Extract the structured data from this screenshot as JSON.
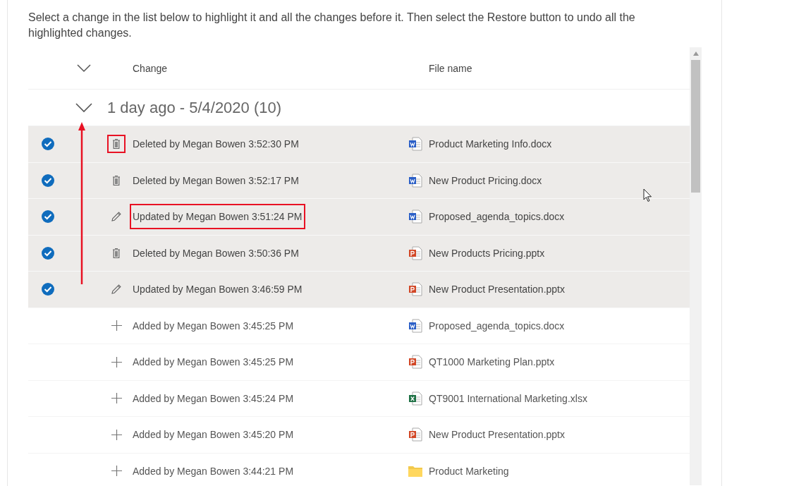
{
  "instructions": "Select a change in the list below to highlight it and all the changes before it. Then select the Restore button to undo all the highlighted changes.",
  "columns": {
    "change": "Change",
    "file_name": "File name"
  },
  "group": {
    "label": "1 day ago - 5/4/2020 (10)",
    "expanded": true
  },
  "rows": [
    {
      "kind": "deleted",
      "selected": true,
      "change": "Deleted by Megan Bowen 3:52:30 PM",
      "file": {
        "kind": "word",
        "name": "Product Marketing Info.docx"
      },
      "icon_marked": true,
      "change_marked": false
    },
    {
      "kind": "deleted",
      "selected": true,
      "change": "Deleted by Megan Bowen 3:52:17 PM",
      "file": {
        "kind": "word",
        "name": "New Product Pricing.docx"
      },
      "icon_marked": false,
      "change_marked": false
    },
    {
      "kind": "updated",
      "selected": true,
      "change": "Updated by Megan Bowen 3:51:24 PM",
      "file": {
        "kind": "word",
        "name": "Proposed_agenda_topics.docx"
      },
      "icon_marked": false,
      "change_marked": true
    },
    {
      "kind": "deleted",
      "selected": true,
      "change": "Deleted by Megan Bowen 3:50:36 PM",
      "file": {
        "kind": "powerpoint",
        "name": "New Products Pricing.pptx"
      },
      "icon_marked": false,
      "change_marked": false
    },
    {
      "kind": "updated",
      "selected": true,
      "change": "Updated by Megan Bowen 3:46:59 PM",
      "file": {
        "kind": "powerpoint",
        "name": "New Product Presentation.pptx"
      },
      "icon_marked": false,
      "change_marked": false
    },
    {
      "kind": "added",
      "selected": false,
      "change": "Added by Megan Bowen 3:45:25 PM",
      "file": {
        "kind": "word",
        "name": "Proposed_agenda_topics.docx"
      },
      "icon_marked": false,
      "change_marked": false
    },
    {
      "kind": "added",
      "selected": false,
      "change": "Added by Megan Bowen 3:45:25 PM",
      "file": {
        "kind": "powerpoint",
        "name": "QT1000 Marketing Plan.pptx"
      },
      "icon_marked": false,
      "change_marked": false
    },
    {
      "kind": "added",
      "selected": false,
      "change": "Added by Megan Bowen 3:45:24 PM",
      "file": {
        "kind": "excel",
        "name": "QT9001 International Marketing.xlsx"
      },
      "icon_marked": false,
      "change_marked": false
    },
    {
      "kind": "added",
      "selected": false,
      "change": "Added by Megan Bowen 3:45:20 PM",
      "file": {
        "kind": "powerpoint",
        "name": "New Product Presentation.pptx"
      },
      "icon_marked": false,
      "change_marked": false
    },
    {
      "kind": "added",
      "selected": false,
      "change": "Added by Megan Bowen 3:44:21 PM",
      "file": {
        "kind": "folder",
        "name": "Product Marketing"
      },
      "icon_marked": false,
      "change_marked": false
    }
  ]
}
